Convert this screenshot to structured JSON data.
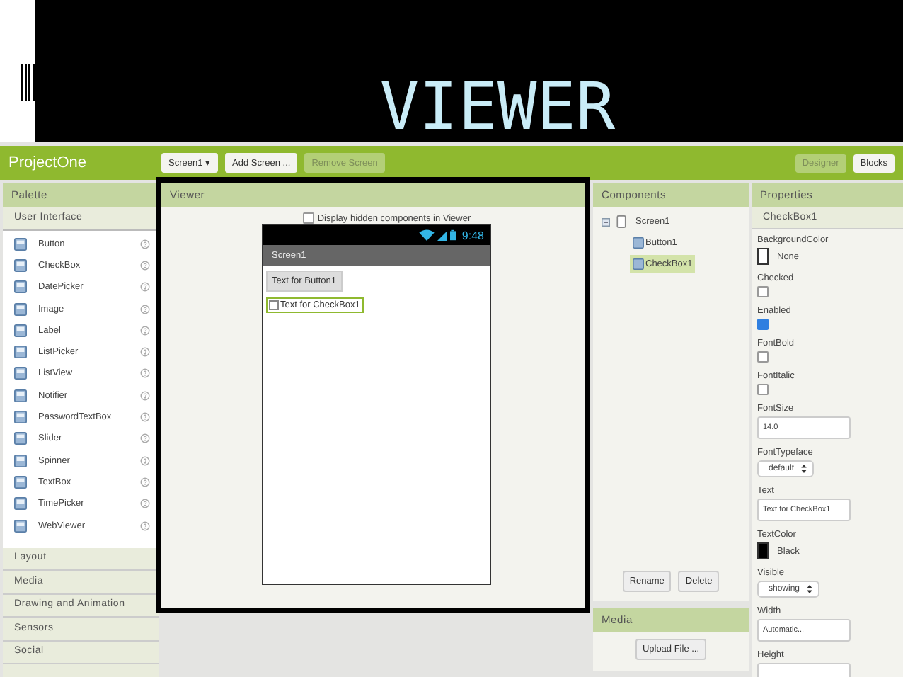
{
  "slide": {
    "title": "VIEWER"
  },
  "app": {
    "project": "ProjectOne",
    "toolbar": [
      {
        "label": "Screen1 ▾",
        "disabled": false
      },
      {
        "label": "Add Screen ...",
        "disabled": false
      },
      {
        "label": "Remove Screen",
        "disabled": true
      }
    ],
    "views": [
      {
        "label": "Designer",
        "selected": true
      },
      {
        "label": "Blocks",
        "selected": false
      }
    ]
  },
  "palette": {
    "title": "Palette",
    "open_category": "User Interface",
    "items": [
      {
        "label": "Button"
      },
      {
        "label": "CheckBox"
      },
      {
        "label": "DatePicker"
      },
      {
        "label": "Image"
      },
      {
        "label": "Label"
      },
      {
        "label": "ListPicker"
      },
      {
        "label": "ListView"
      },
      {
        "label": "Notifier"
      },
      {
        "label": "PasswordTextBox"
      },
      {
        "label": "Slider"
      },
      {
        "label": "Spinner"
      },
      {
        "label": "TextBox"
      },
      {
        "label": "TimePicker"
      },
      {
        "label": "WebViewer"
      }
    ],
    "categories": [
      "Layout",
      "Media",
      "Drawing and Animation",
      "Sensors",
      "Social"
    ]
  },
  "viewer": {
    "title": "Viewer",
    "hidden_option": {
      "label": "Display hidden components in Viewer",
      "checked": false
    },
    "phone": {
      "time": "9:48",
      "screen_title": "Screen1",
      "button_text": "Text for Button1",
      "checkbox": {
        "label": "Text for CheckBox1",
        "checked": false
      }
    }
  },
  "components": {
    "title": "Components",
    "tree": [
      {
        "label": "Screen1",
        "expanded": true,
        "selected": false,
        "children": [
          {
            "label": "Button1",
            "selected": false
          },
          {
            "label": "CheckBox1",
            "selected": true
          }
        ]
      }
    ],
    "buttons": [
      "Rename",
      "Delete"
    ]
  },
  "media": {
    "title": "Media",
    "button": "Upload File ..."
  },
  "properties": {
    "title": "Properties",
    "component": "CheckBox1",
    "items": [
      {
        "label": "BackgroundColor",
        "kind": "color",
        "value": "None",
        "color": "#ffffff"
      },
      {
        "label": "Checked",
        "kind": "checkbox",
        "checked": false
      },
      {
        "label": "Enabled",
        "kind": "checkbox",
        "checked": true
      },
      {
        "label": "FontBold",
        "kind": "checkbox",
        "checked": false
      },
      {
        "label": "FontItalic",
        "kind": "checkbox",
        "checked": false
      },
      {
        "label": "FontSize",
        "kind": "text",
        "value": "14.0"
      },
      {
        "label": "FontTypeface",
        "kind": "select",
        "value": "default"
      },
      {
        "label": "Text",
        "kind": "text",
        "value": "Text for CheckBox1"
      },
      {
        "label": "TextColor",
        "kind": "color",
        "value": "Black",
        "color": "#000000"
      },
      {
        "label": "Visible",
        "kind": "select",
        "value": "showing"
      },
      {
        "label": "Width",
        "kind": "text",
        "value": "Automatic..."
      },
      {
        "label": "Height",
        "kind": "text"
      }
    ]
  }
}
